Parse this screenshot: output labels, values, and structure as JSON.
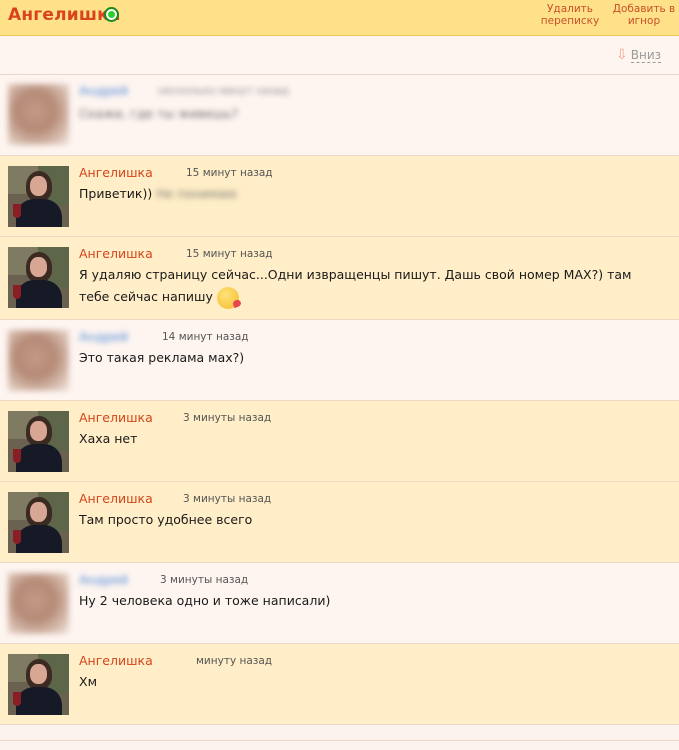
{
  "header": {
    "title": "Ангелишка",
    "delete_label": "Удалить переписку",
    "ignore_label": "Добавить в игнор"
  },
  "subbar": {
    "down_label": "Вниз"
  },
  "messages": [
    {
      "name": "Андрей",
      "time": "несколько минут назад",
      "text": "Скажи, где ты живешь?",
      "mine": false,
      "blurred": true
    },
    {
      "name": "Ангелишка",
      "time": "15 минут назад",
      "text": "Приветик))",
      "text_blur": "Не понимаю",
      "mine": true
    },
    {
      "name": "Ангелишка",
      "time": "15 минут назад",
      "text": "Я удаляю страницу сейчас...Одни извращенцы пишут. Дашь свой номер МАХ?) там тебе сейчас напишу",
      "emoji": "kiss-emoji",
      "mine": true
    },
    {
      "name": "Андрей",
      "time": "14 минут назад",
      "text": "Это такая реклама мах?)",
      "mine": false
    },
    {
      "name": "Ангелишка",
      "time": "3 минуты назад",
      "text": "Хаха нет",
      "mine": true
    },
    {
      "name": "Ангелишка",
      "time": "3 минуты назад",
      "text": "Там просто удобнее всего",
      "mine": true
    },
    {
      "name": "Андрей",
      "time": "3 минуты назад",
      "text": "Ну 2 человека одно и тоже написали)",
      "mine": false
    },
    {
      "name": "Ангелишка",
      "time": "минуту назад",
      "text": "Хм",
      "mine": true
    }
  ]
}
